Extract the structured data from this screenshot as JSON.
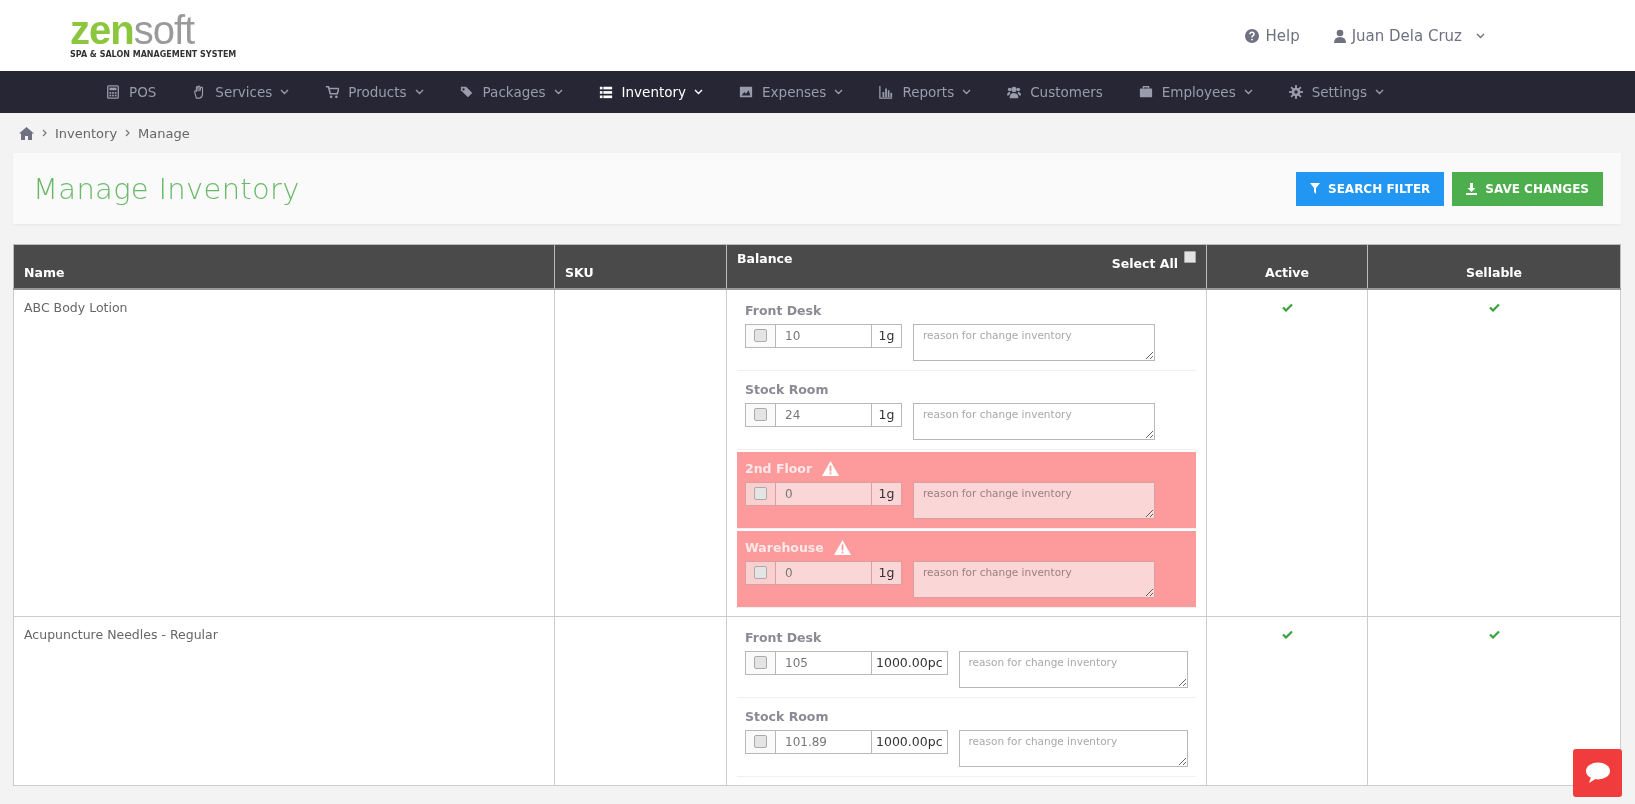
{
  "logo": {
    "primary": "zen",
    "secondary": "soft",
    "tagline": "SPA & SALON MANAGEMENT SYSTEM"
  },
  "header_links": [
    {
      "kind": "help",
      "label": "Help"
    },
    {
      "kind": "user",
      "label": "Juan Dela Cruz"
    }
  ],
  "nav": [
    {
      "label": "POS",
      "dropdown": false,
      "selected": false
    },
    {
      "label": "Services",
      "dropdown": true,
      "selected": false
    },
    {
      "label": "Products",
      "dropdown": true,
      "selected": false
    },
    {
      "label": "Packages",
      "dropdown": true,
      "selected": false
    },
    {
      "label": "Inventory",
      "dropdown": true,
      "selected": true
    },
    {
      "label": "Expenses",
      "dropdown": true,
      "selected": false
    },
    {
      "label": "Reports",
      "dropdown": true,
      "selected": false
    },
    {
      "label": "Customers",
      "dropdown": false,
      "selected": false
    },
    {
      "label": "Employees",
      "dropdown": true,
      "selected": false
    },
    {
      "label": "Settings",
      "dropdown": true,
      "selected": false
    }
  ],
  "breadcrumb": [
    "Inventory",
    "Manage"
  ],
  "page_title": "Manage Inventory",
  "buttons": [
    {
      "kind": "filter",
      "label": "SEARCH FILTER"
    },
    {
      "kind": "save",
      "label": "SAVE CHANGES"
    }
  ],
  "table": {
    "columns": {
      "name": "Name",
      "sku": "SKU",
      "balance": "Balance",
      "select_all": "Select All",
      "active": "Active",
      "sellable": "Sellable"
    },
    "select_all_checked": false,
    "rows": [
      {
        "name": "ABC Body Lotion",
        "active": true,
        "sellable": true,
        "locations": [
          {
            "label": "Front Desk",
            "warning": false,
            "checked": false,
            "quantity": "10",
            "unit": "1g",
            "placeholder": "reason for change inventory"
          },
          {
            "label": "Stock Room",
            "warning": false,
            "checked": false,
            "quantity": "24",
            "unit": "1g",
            "placeholder": "reason for change inventory"
          },
          {
            "label": "2nd Floor",
            "warning": true,
            "checked": false,
            "quantity": "0",
            "unit": "1g",
            "placeholder": "reason for change inventory"
          },
          {
            "label": "Warehouse",
            "warning": true,
            "checked": false,
            "quantity": "0",
            "unit": "1g",
            "placeholder": "reason for change inventory"
          }
        ]
      },
      {
        "name": "Acupuncture Needles - Regular",
        "active": true,
        "sellable": true,
        "locations": [
          {
            "label": "Front Desk",
            "warning": false,
            "checked": false,
            "quantity": "105",
            "unit": "1000.00pc",
            "placeholder": "reason for change inventory"
          },
          {
            "label": "Stock Room",
            "warning": false,
            "checked": false,
            "quantity": "101.89",
            "unit": "1000.00pc",
            "placeholder": "reason for change inventory"
          }
        ]
      }
    ]
  }
}
